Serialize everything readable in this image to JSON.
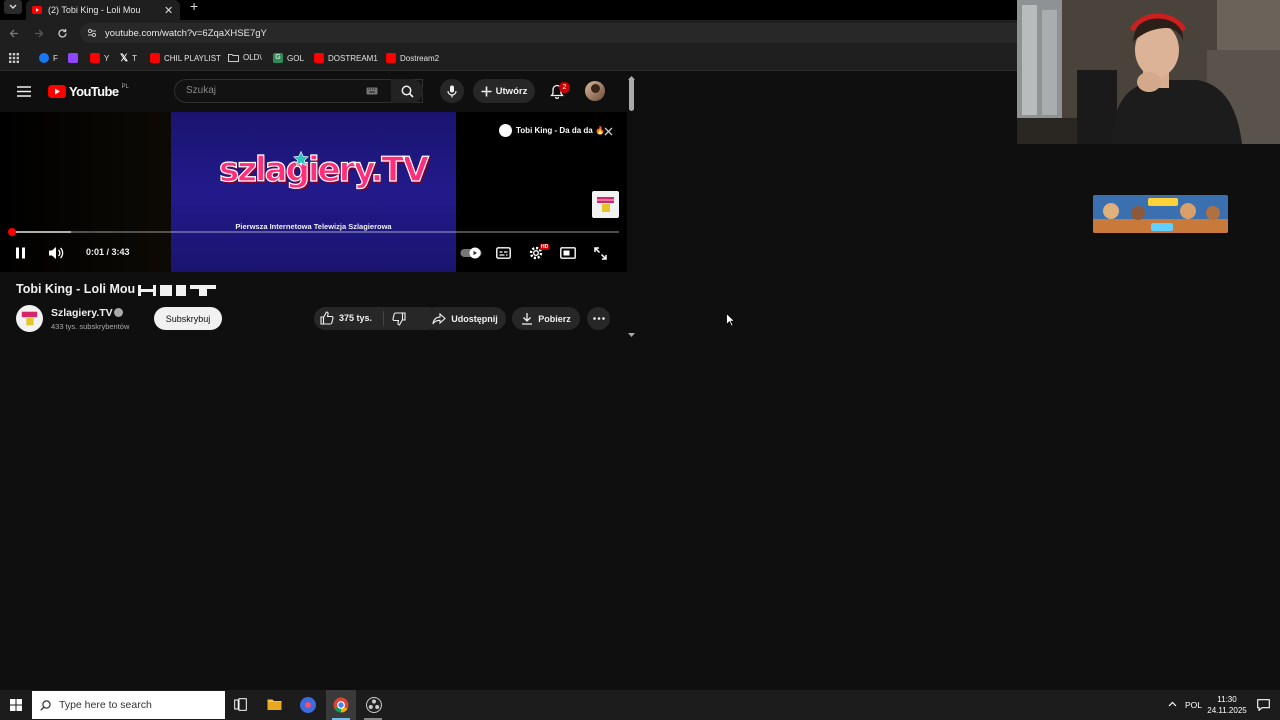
{
  "browser": {
    "tab_title": "(2) Tobi King - Loli Mou",
    "new_tab_label": "+",
    "close_tab_label": "✕",
    "url": "youtube.com/watch?v=6ZqaXHSE7gY",
    "bookmarks": [
      {
        "label": "F",
        "icon": "facebook-icon",
        "color": "#1877f2"
      },
      {
        "label": "",
        "icon": "twitch-icon",
        "color": "#9146ff"
      },
      {
        "label": "Y",
        "icon": "youtube-icon",
        "color": "#ff0000"
      },
      {
        "label": "T",
        "icon": "x-icon",
        "color": "#ffffff"
      },
      {
        "label": "CHIL PLAYLIST",
        "icon": "youtube-icon",
        "color": "#ff0000"
      },
      {
        "label": "OLD\\",
        "icon": "folder-icon",
        "color": "#c8c8c8"
      },
      {
        "label": "GOL",
        "icon": "gol-icon",
        "color": "#2e8b57"
      },
      {
        "label": "DOSTREAM1",
        "icon": "youtube-icon",
        "color": "#ff0000"
      },
      {
        "label": "Dostream2",
        "icon": "youtube-icon",
        "color": "#ff0000"
      }
    ]
  },
  "youtube": {
    "logo_text": "YouTube",
    "region": "PL",
    "search_placeholder": "Szukaj",
    "create_label": "Utwórz",
    "notifications_count": "2",
    "accent_color": "#ff0000"
  },
  "player": {
    "brand_name": "szlagiery.TV",
    "tagline": "Pierwsza Internetowa Telewizja Szlagierowa",
    "time": "0:01 / 3:43",
    "progress": 0.003,
    "buffered": 0.1,
    "next_card_title": "Tobi King - Da da da 🔥",
    "settings_badge": "HD"
  },
  "video": {
    "title": "Tobi King - Loli Mou",
    "channel": "Szlagiery.TV",
    "subscribers": "433 tys. subskrybentów",
    "subscribe_label": "Subskrybuj",
    "likes": "375 tys.",
    "share_label": "Udostępnij",
    "download_label": "Pobierz"
  },
  "taskbar": {
    "search_placeholder": "Type here to search",
    "language": "POL",
    "time": "11:30",
    "date": "24.11.2025"
  }
}
